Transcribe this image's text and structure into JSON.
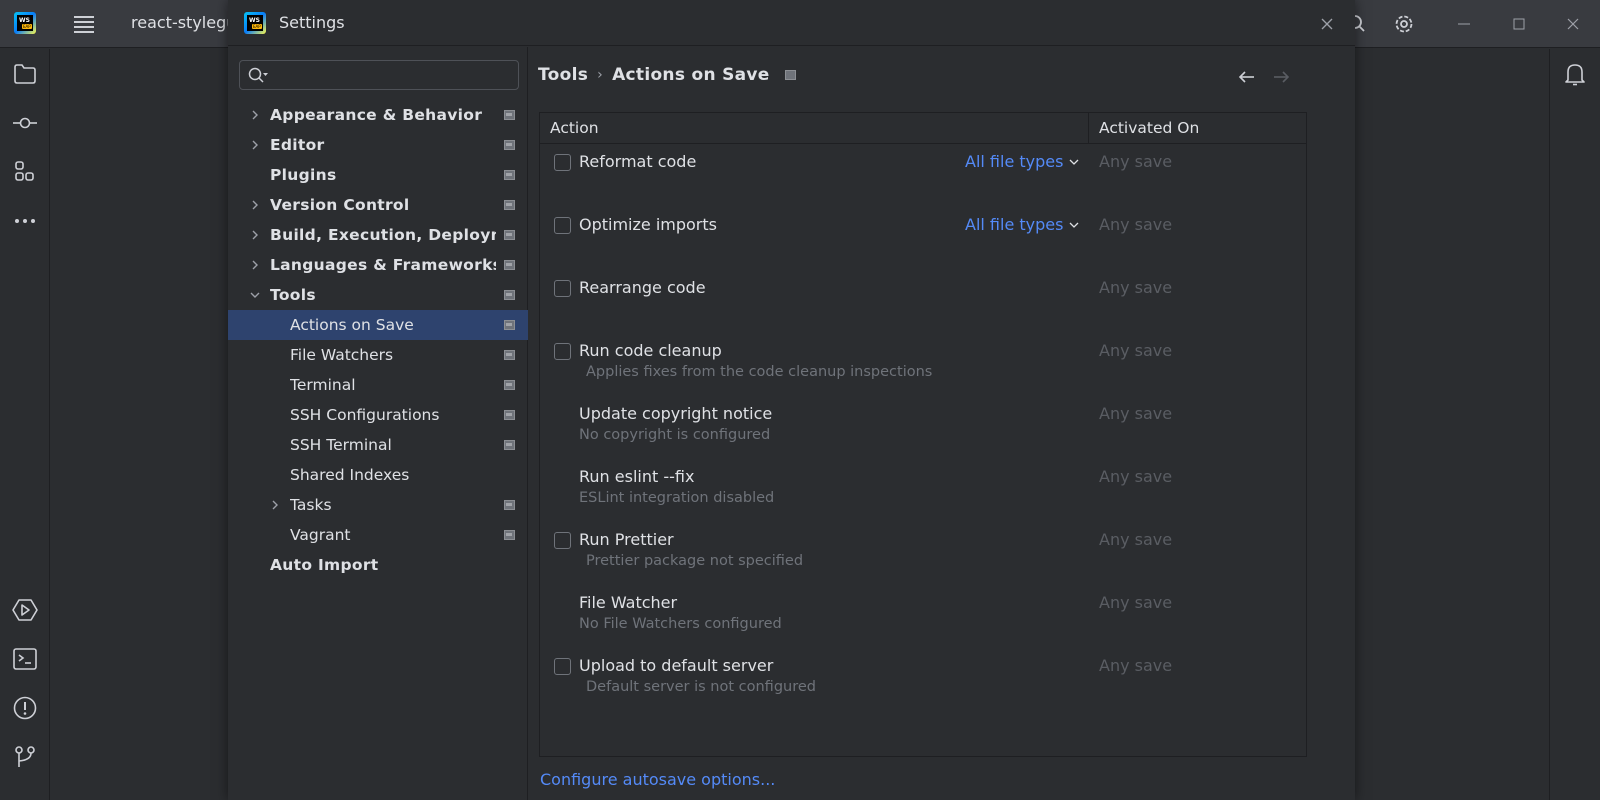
{
  "ide": {
    "project_name": "react-styleguidist",
    "icons": {
      "logo": "webstorm-eap-logo",
      "menu": "hamburger-menu-icon",
      "search": "search-icon",
      "settings": "gear-icon",
      "minimize": "minimize-icon",
      "maximize": "maximize-icon",
      "close": "close-icon"
    },
    "left_toolbar": [
      "folder-icon",
      "commit-icon",
      "structure-icon",
      "more-icon"
    ],
    "left_toolbar_bottom": [
      "services-icon",
      "terminal-icon",
      "problems-icon",
      "git-icon"
    ],
    "right_toolbar": [
      "notifications-icon"
    ]
  },
  "dialog": {
    "title": "Settings",
    "search": {
      "value": "",
      "placeholder": ""
    },
    "nav": [
      {
        "label": "Appearance & Behavior",
        "level": 0,
        "expander": "collapsed",
        "bold": true,
        "project": true
      },
      {
        "label": "Editor",
        "level": 0,
        "expander": "collapsed",
        "bold": true,
        "project": true
      },
      {
        "label": "Plugins",
        "level": 0,
        "expander": "none",
        "bold": true,
        "project": true
      },
      {
        "label": "Version Control",
        "level": 0,
        "expander": "collapsed",
        "bold": true,
        "project": true
      },
      {
        "label": "Build, Execution, Deployment",
        "level": 0,
        "expander": "collapsed",
        "bold": true,
        "project": true
      },
      {
        "label": "Languages & Frameworks",
        "level": 0,
        "expander": "collapsed",
        "bold": true,
        "project": true
      },
      {
        "label": "Tools",
        "level": 0,
        "expander": "expanded",
        "bold": true,
        "project": true
      },
      {
        "label": "Actions on Save",
        "level": 1,
        "expander": "none",
        "bold": false,
        "project": true,
        "selected": true
      },
      {
        "label": "File Watchers",
        "level": 1,
        "expander": "none",
        "bold": false,
        "project": true
      },
      {
        "label": "Terminal",
        "level": 1,
        "expander": "none",
        "bold": false,
        "project": true
      },
      {
        "label": "SSH Configurations",
        "level": 1,
        "expander": "none",
        "bold": false,
        "project": true
      },
      {
        "label": "SSH Terminal",
        "level": 1,
        "expander": "none",
        "bold": false,
        "project": true
      },
      {
        "label": "Shared Indexes",
        "level": 1,
        "expander": "none",
        "bold": false,
        "project": false
      },
      {
        "label": "Tasks",
        "level": 1,
        "expander": "collapsed",
        "bold": false,
        "project": true
      },
      {
        "label": "Vagrant",
        "level": 1,
        "expander": "none",
        "bold": false,
        "project": true
      },
      {
        "label": "Auto Import",
        "level": 0,
        "expander": "none",
        "bold": true,
        "project": false
      }
    ],
    "breadcrumb": {
      "parent": "Tools",
      "separator": "›",
      "current": "Actions on Save"
    },
    "table": {
      "headers": {
        "action": "Action",
        "activated_on": "Activated On"
      },
      "rows": [
        {
          "title": "Reformat code",
          "checkbox": true,
          "checked": false,
          "description": "",
          "file_types": "All file types",
          "activated_on": "Any save"
        },
        {
          "title": "Optimize imports",
          "checkbox": true,
          "checked": false,
          "description": "",
          "file_types": "All file types",
          "activated_on": "Any save"
        },
        {
          "title": "Rearrange code",
          "checkbox": true,
          "checked": false,
          "description": "",
          "file_types": "",
          "activated_on": "Any save"
        },
        {
          "title": "Run code cleanup",
          "checkbox": true,
          "checked": false,
          "description": "Applies fixes from the code cleanup inspections",
          "file_types": "",
          "activated_on": "Any save"
        },
        {
          "title": "Update copyright notice",
          "checkbox": false,
          "checked": false,
          "description": "No copyright is configured",
          "file_types": "",
          "activated_on": "Any save"
        },
        {
          "title": "Run eslint --fix",
          "checkbox": false,
          "checked": false,
          "description": "ESLint integration disabled",
          "file_types": "",
          "activated_on": "Any save"
        },
        {
          "title": "Run Prettier",
          "checkbox": true,
          "checked": false,
          "description": "Prettier package not specified",
          "file_types": "",
          "activated_on": "Any save"
        },
        {
          "title": "File Watcher",
          "checkbox": false,
          "checked": false,
          "description": "No File Watchers configured",
          "file_types": "",
          "activated_on": "Any save"
        },
        {
          "title": "Upload to default server",
          "checkbox": true,
          "checked": false,
          "description": "Default server is not configured",
          "file_types": "",
          "activated_on": "Any save"
        }
      ]
    },
    "footer_link": "Configure autosave options...",
    "colors": {
      "accent_link": "#548af7",
      "selection": "#2e436e",
      "background": "#2b2d30",
      "muted_text": "#6f737a"
    }
  }
}
